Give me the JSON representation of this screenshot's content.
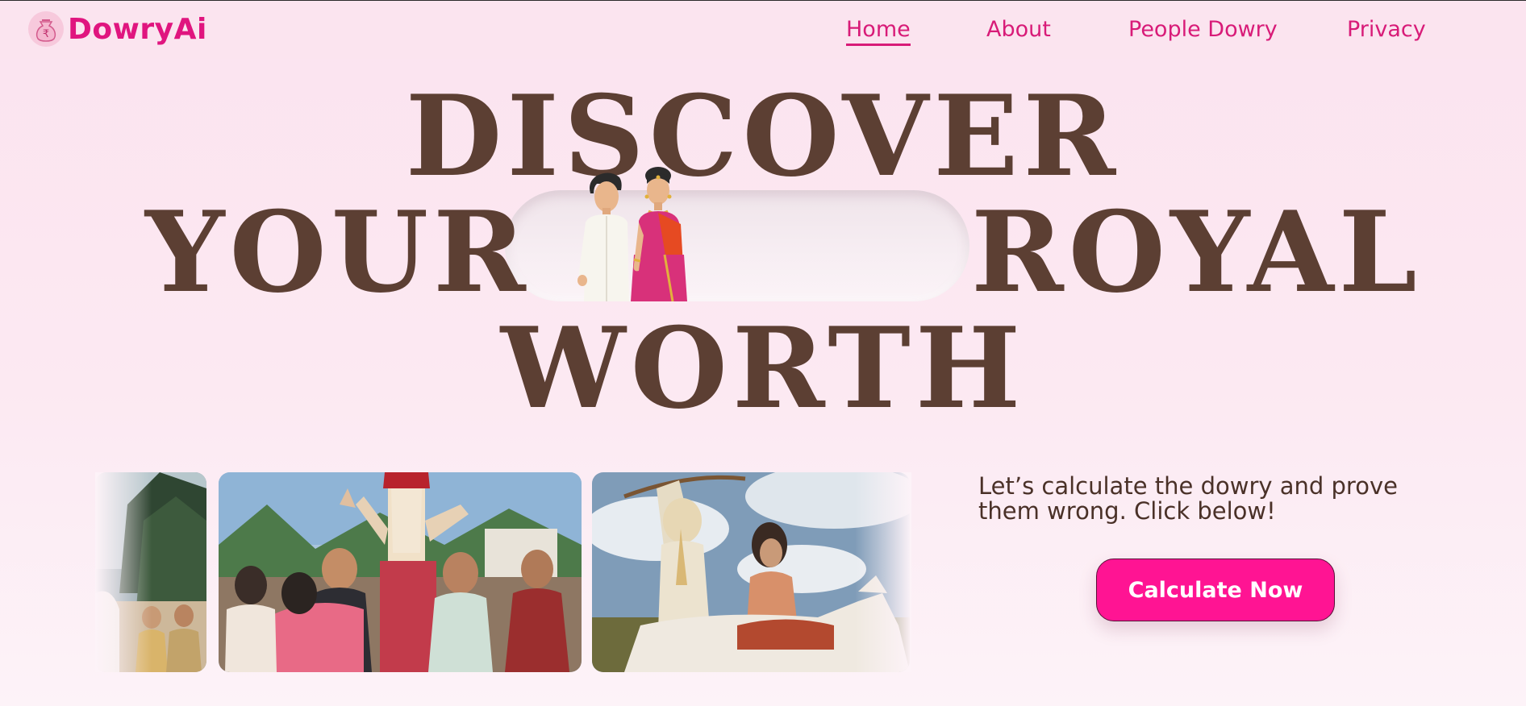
{
  "brand": {
    "name": "DowryAi",
    "icon": "rupee-bag-icon",
    "accent": "#e0157f"
  },
  "nav": {
    "items": [
      {
        "label": "Home",
        "active": true
      },
      {
        "label": "About",
        "active": false
      },
      {
        "label": "People Dowry",
        "active": false
      },
      {
        "label": "Privacy",
        "active": false
      }
    ]
  },
  "hero": {
    "line1": "DISCOVER",
    "line2_left": "YOUR",
    "line2_right": "ROYAL",
    "line3": "WORTH",
    "illustration": "bride-groom-couple-icon",
    "text_color": "#5c3f33"
  },
  "gallery": {
    "photos": [
      {
        "subject": "wedding-guests-photo"
      },
      {
        "subject": "baraat-dance-photo"
      },
      {
        "subject": "groom-horse-bride-photo"
      }
    ]
  },
  "cta": {
    "text": "Let’s calculate the dowry and prove them wrong. Click below!",
    "button_label": "Calculate Now",
    "button_color": "#ff1493"
  }
}
